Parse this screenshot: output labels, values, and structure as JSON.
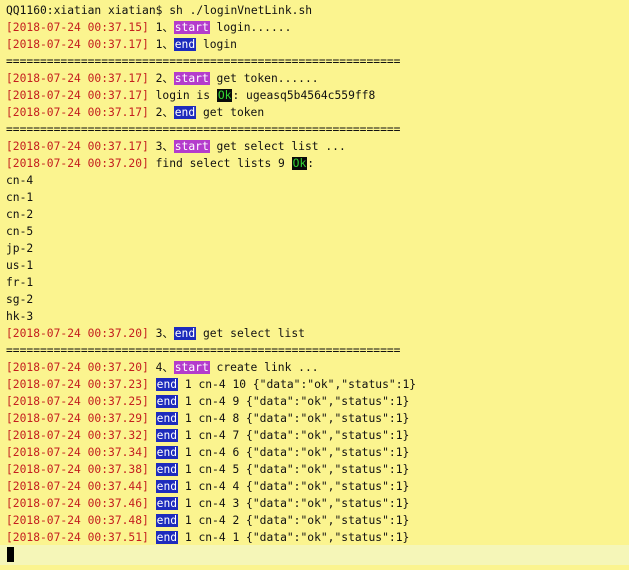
{
  "terminal": {
    "prompt": "QQ1160:xiatian xiatian$ sh ./loginVnetLink.sh",
    "separator": "==========================================================",
    "colors": {
      "background": "#fbf48f",
      "timestamp": "#c41e1e",
      "start_tag_bg": "#b43ccc",
      "end_tag_bg": "#1d2bbd",
      "ok_tag_bg": "#0a0a0a",
      "ok_tag_fg": "#33d633"
    },
    "lines": [
      {
        "type": "prompt"
      },
      {
        "type": "log",
        "parts": [
          {
            "k": "ts",
            "t": "[2018-07-24 00:37.15]"
          },
          {
            "k": "txt",
            "t": " 1、"
          },
          {
            "k": "start",
            "t": "start"
          },
          {
            "k": "txt",
            "t": " login......"
          }
        ]
      },
      {
        "type": "log",
        "parts": [
          {
            "k": "ts",
            "t": "[2018-07-24 00:37.17]"
          },
          {
            "k": "txt",
            "t": " 1、"
          },
          {
            "k": "end",
            "t": "end"
          },
          {
            "k": "txt",
            "t": " login"
          }
        ]
      },
      {
        "type": "sep"
      },
      {
        "type": "log",
        "parts": [
          {
            "k": "ts",
            "t": "[2018-07-24 00:37.17]"
          },
          {
            "k": "txt",
            "t": " 2、"
          },
          {
            "k": "start",
            "t": "start"
          },
          {
            "k": "txt",
            "t": " get token......"
          }
        ]
      },
      {
        "type": "log",
        "parts": [
          {
            "k": "ts",
            "t": "[2018-07-24 00:37.17]"
          },
          {
            "k": "txt",
            "t": " login is "
          },
          {
            "k": "ok",
            "t": "Ok"
          },
          {
            "k": "txt",
            "t": ": ugeasq5b4564c559ff8"
          }
        ]
      },
      {
        "type": "log",
        "parts": [
          {
            "k": "ts",
            "t": "[2018-07-24 00:37.17]"
          },
          {
            "k": "txt",
            "t": " 2、"
          },
          {
            "k": "end",
            "t": "end"
          },
          {
            "k": "txt",
            "t": " get token"
          }
        ]
      },
      {
        "type": "sep"
      },
      {
        "type": "log",
        "parts": [
          {
            "k": "ts",
            "t": "[2018-07-24 00:37.17]"
          },
          {
            "k": "txt",
            "t": " 3、"
          },
          {
            "k": "start",
            "t": "start"
          },
          {
            "k": "txt",
            "t": " get select list ..."
          }
        ]
      },
      {
        "type": "log",
        "parts": [
          {
            "k": "ts",
            "t": "[2018-07-24 00:37.20]"
          },
          {
            "k": "txt",
            "t": " find select lists 9 "
          },
          {
            "k": "ok",
            "t": "Ok"
          },
          {
            "k": "txt",
            "t": ":"
          }
        ]
      },
      {
        "type": "plain",
        "text": "cn-4"
      },
      {
        "type": "plain",
        "text": "cn-1"
      },
      {
        "type": "plain",
        "text": "cn-2"
      },
      {
        "type": "plain",
        "text": "cn-5"
      },
      {
        "type": "plain",
        "text": "jp-2"
      },
      {
        "type": "plain",
        "text": "us-1"
      },
      {
        "type": "plain",
        "text": "fr-1"
      },
      {
        "type": "plain",
        "text": "sg-2"
      },
      {
        "type": "plain",
        "text": "hk-3"
      },
      {
        "type": "log",
        "parts": [
          {
            "k": "ts",
            "t": "[2018-07-24 00:37.20]"
          },
          {
            "k": "txt",
            "t": " 3、"
          },
          {
            "k": "end",
            "t": "end"
          },
          {
            "k": "txt",
            "t": " get select list"
          }
        ]
      },
      {
        "type": "sep"
      },
      {
        "type": "log",
        "parts": [
          {
            "k": "ts",
            "t": "[2018-07-24 00:37.20]"
          },
          {
            "k": "txt",
            "t": " 4、"
          },
          {
            "k": "start",
            "t": "start"
          },
          {
            "k": "txt",
            "t": " create link ..."
          }
        ]
      },
      {
        "type": "log",
        "parts": [
          {
            "k": "ts",
            "t": "[2018-07-24 00:37.23]"
          },
          {
            "k": "txt",
            "t": " "
          },
          {
            "k": "end",
            "t": "end"
          },
          {
            "k": "txt",
            "t": " 1 cn-4 10 {\"data\":\"ok\",\"status\":1}"
          }
        ]
      },
      {
        "type": "log",
        "parts": [
          {
            "k": "ts",
            "t": "[2018-07-24 00:37.25]"
          },
          {
            "k": "txt",
            "t": " "
          },
          {
            "k": "end",
            "t": "end"
          },
          {
            "k": "txt",
            "t": " 1 cn-4 9 {\"data\":\"ok\",\"status\":1}"
          }
        ]
      },
      {
        "type": "log",
        "parts": [
          {
            "k": "ts",
            "t": "[2018-07-24 00:37.29]"
          },
          {
            "k": "txt",
            "t": " "
          },
          {
            "k": "end",
            "t": "end"
          },
          {
            "k": "txt",
            "t": " 1 cn-4 8 {\"data\":\"ok\",\"status\":1}"
          }
        ]
      },
      {
        "type": "log",
        "parts": [
          {
            "k": "ts",
            "t": "[2018-07-24 00:37.32]"
          },
          {
            "k": "txt",
            "t": " "
          },
          {
            "k": "end",
            "t": "end"
          },
          {
            "k": "txt",
            "t": " 1 cn-4 7 {\"data\":\"ok\",\"status\":1}"
          }
        ]
      },
      {
        "type": "log",
        "parts": [
          {
            "k": "ts",
            "t": "[2018-07-24 00:37.34]"
          },
          {
            "k": "txt",
            "t": " "
          },
          {
            "k": "end",
            "t": "end"
          },
          {
            "k": "txt",
            "t": " 1 cn-4 6 {\"data\":\"ok\",\"status\":1}"
          }
        ]
      },
      {
        "type": "log",
        "parts": [
          {
            "k": "ts",
            "t": "[2018-07-24 00:37.38]"
          },
          {
            "k": "txt",
            "t": " "
          },
          {
            "k": "end",
            "t": "end"
          },
          {
            "k": "txt",
            "t": " 1 cn-4 5 {\"data\":\"ok\",\"status\":1}"
          }
        ]
      },
      {
        "type": "log",
        "parts": [
          {
            "k": "ts",
            "t": "[2018-07-24 00:37.44]"
          },
          {
            "k": "txt",
            "t": " "
          },
          {
            "k": "end",
            "t": "end"
          },
          {
            "k": "txt",
            "t": " 1 cn-4 4 {\"data\":\"ok\",\"status\":1}"
          }
        ]
      },
      {
        "type": "log",
        "parts": [
          {
            "k": "ts",
            "t": "[2018-07-24 00:37.46]"
          },
          {
            "k": "txt",
            "t": " "
          },
          {
            "k": "end",
            "t": "end"
          },
          {
            "k": "txt",
            "t": " 1 cn-4 3 {\"data\":\"ok\",\"status\":1}"
          }
        ]
      },
      {
        "type": "log",
        "parts": [
          {
            "k": "ts",
            "t": "[2018-07-24 00:37.48]"
          },
          {
            "k": "txt",
            "t": " "
          },
          {
            "k": "end",
            "t": "end"
          },
          {
            "k": "txt",
            "t": " 1 cn-4 2 {\"data\":\"ok\",\"status\":1}"
          }
        ]
      },
      {
        "type": "log",
        "parts": [
          {
            "k": "ts",
            "t": "[2018-07-24 00:37.51]"
          },
          {
            "k": "txt",
            "t": " "
          },
          {
            "k": "end",
            "t": "end"
          },
          {
            "k": "txt",
            "t": " 1 cn-4 1 {\"data\":\"ok\",\"status\":1}"
          }
        ]
      }
    ]
  }
}
